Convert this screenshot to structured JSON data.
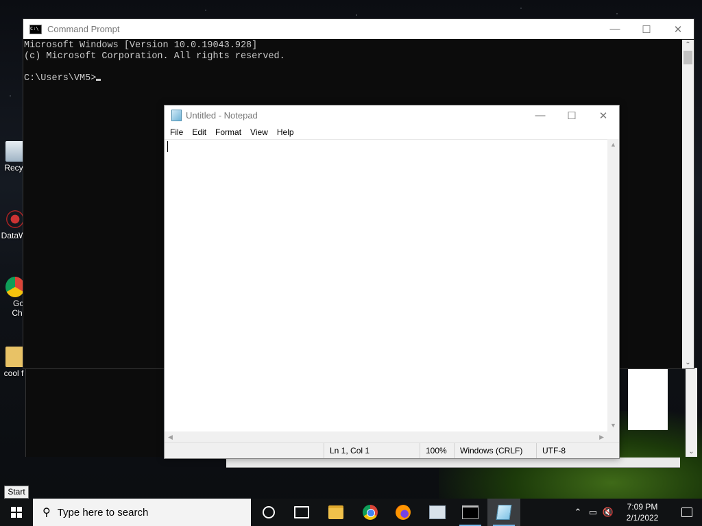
{
  "desktop": {
    "icons": [
      {
        "label": "Recy"
      },
      {
        "label": "DataW"
      },
      {
        "label": "Go",
        "label2": "Chr"
      },
      {
        "label": "cool f"
      }
    ]
  },
  "cmd": {
    "title": "Command Prompt",
    "lines": [
      "Microsoft Windows [Version 10.0.19043.928]",
      "(c) Microsoft Corporation. All rights reserved.",
      "",
      "C:\\Users\\VM5>"
    ]
  },
  "notepad": {
    "title": "Untitled - Notepad",
    "menu": [
      "File",
      "Edit",
      "Format",
      "View",
      "Help"
    ],
    "content": "",
    "status": {
      "position": "Ln 1, Col 1",
      "zoom": "100%",
      "line_ending": "Windows (CRLF)",
      "encoding": "UTF-8"
    }
  },
  "tooltip": "Start",
  "taskbar": {
    "search_placeholder": "Type here to search",
    "apps": [
      "cortana-icon",
      "task-view-icon",
      "file-explorer-icon",
      "chrome-icon",
      "firefox-icon",
      "documents-icon",
      "command-prompt-icon",
      "notepad-icon"
    ],
    "clock": {
      "time": "7:09 PM",
      "date": "2/1/2022"
    }
  },
  "colors": {
    "cmd_background": "#0c0c0c",
    "cmd_text": "#cccccc",
    "taskbar": "#101214",
    "taskbar_running_indicator": "#76b9ed"
  }
}
